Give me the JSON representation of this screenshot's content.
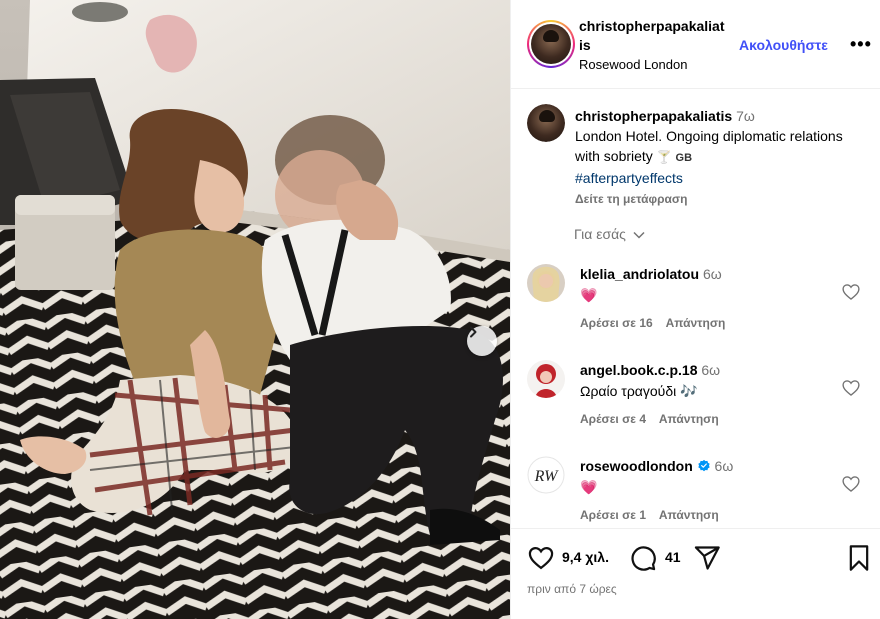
{
  "post": {
    "author": "christopherpapakaliatis",
    "author_wrapped": "christopherpapakaliat is",
    "location": "Rosewood London",
    "follow_label": "Ακολουθήστε",
    "more_label": "•••"
  },
  "caption": {
    "author": "christopherpapakaliatis",
    "time": "7ω",
    "text": "London Hotel. Ongoing diplomatic relations with sobriety",
    "emoji": "🍸",
    "flag": "GB",
    "hashtag": "#afterpartyeffects",
    "translate_label": "Δείτε τη μετάφραση"
  },
  "for_you_label": "Για εσάς",
  "comments": [
    {
      "user": "klelia_andriolatou",
      "time": "6ω",
      "text": "💗",
      "likes": "Αρέσει σε 16",
      "reply": "Απάντηση",
      "verified": false
    },
    {
      "user": "angel.book.c.p.18",
      "time": "6ω",
      "text": "Ωραίο τραγούδι 🎶",
      "likes": "Αρέσει σε 4",
      "reply": "Απάντηση",
      "verified": false
    },
    {
      "user": "rosewoodlondon",
      "time": "6ω",
      "text": "💗",
      "likes": "Αρέσει σε 1",
      "reply": "Απάντηση",
      "verified": true
    }
  ],
  "actions": {
    "likes_count": "9,4 χιλ.",
    "comments_count": "41",
    "posted_ago": "πριν από 7 ώρες"
  },
  "colors": {
    "follow": "#4150f7",
    "hashtag": "#00376b",
    "verified": "#0095f6",
    "muted": "#737373"
  },
  "icons": [
    "chevron-right-icon",
    "more-icon",
    "chevron-down-icon",
    "heart-icon",
    "comment-icon",
    "share-icon",
    "bookmark-icon",
    "verified-icon"
  ]
}
